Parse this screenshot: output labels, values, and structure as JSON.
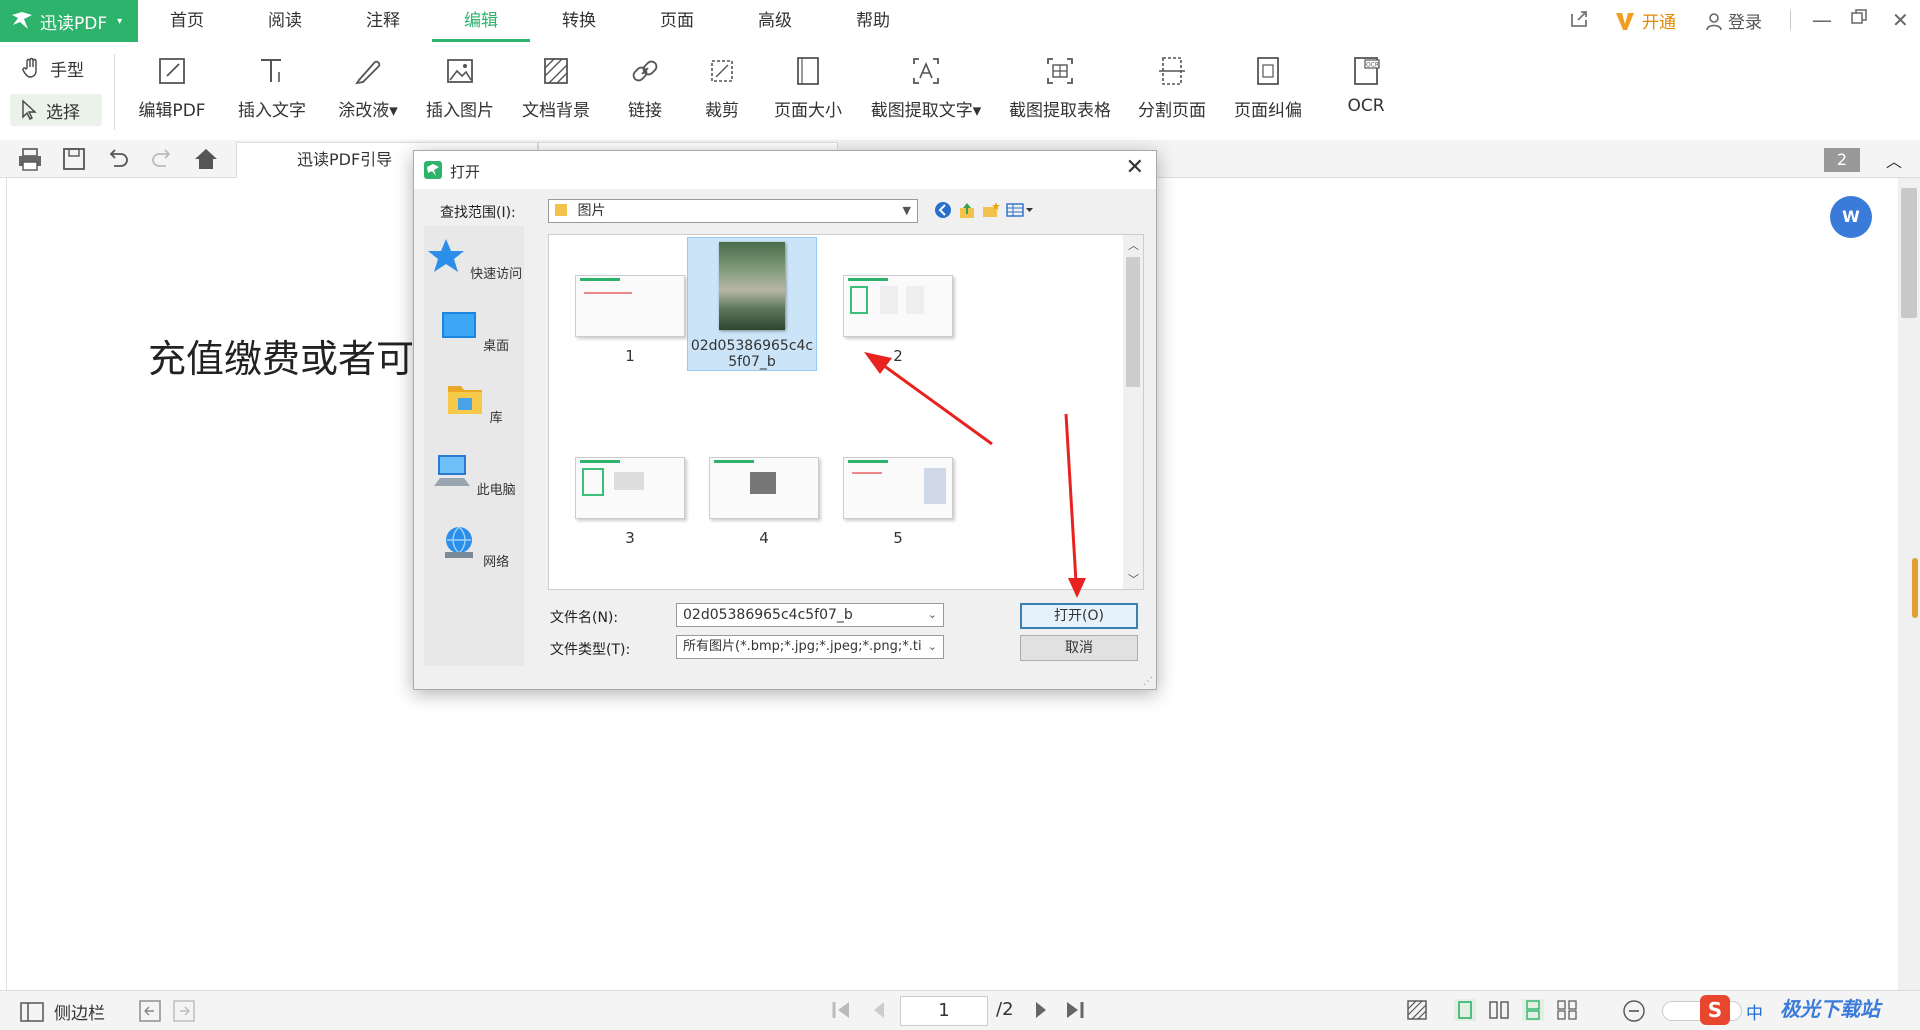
{
  "app": {
    "brand": "迅读PDF",
    "menu_tabs": [
      "首页",
      "阅读",
      "注释",
      "编辑",
      "转换",
      "页面",
      "高级",
      "帮助"
    ],
    "active_tab": "编辑",
    "vip_label": "开通",
    "login_label": "登录"
  },
  "ribbon": {
    "hand_tool": "手型",
    "select_tool": "选择",
    "buttons": [
      "编辑PDF",
      "插入文字",
      "涂改液",
      "插入图片",
      "文档背景",
      "链接",
      "裁剪",
      "页面大小",
      "截图提取文字",
      "截图提取表格",
      "分割页面",
      "页面纠偏",
      "OCR"
    ]
  },
  "tabs": {
    "doc_tab": "迅读PDF引导",
    "page_badge": "2"
  },
  "document": {
    "text": "充值缴费或者可"
  },
  "status": {
    "sidebar_label": "侧边栏",
    "current_page": "1",
    "total_pages": "/2",
    "ime": "中",
    "watermark": "极光下载站"
  },
  "dialog": {
    "title": "打开",
    "lookin_label": "查找范围(I):",
    "lookin_value": "图片",
    "places": [
      "快速访问",
      "桌面",
      "库",
      "此电脑",
      "网络"
    ],
    "files": [
      {
        "name": "1"
      },
      {
        "name": "02d05386965c4c5f07_b"
      },
      {
        "name": "2"
      },
      {
        "name": "3"
      },
      {
        "name": "4"
      },
      {
        "name": "5"
      }
    ],
    "filename_label": "文件名(N):",
    "filename_value": "02d05386965c4c5f07_b",
    "filetype_label": "文件类型(T):",
    "filetype_value": "所有图片(*.bmp;*.jpg;*.jpeg;*.png;*.ti",
    "open_button": "打开(O)",
    "cancel_button": "取消"
  },
  "colors": {
    "brand_green": "#2db36b",
    "selection_blue": "#cce4f7",
    "arrow_red": "#e8231f"
  }
}
